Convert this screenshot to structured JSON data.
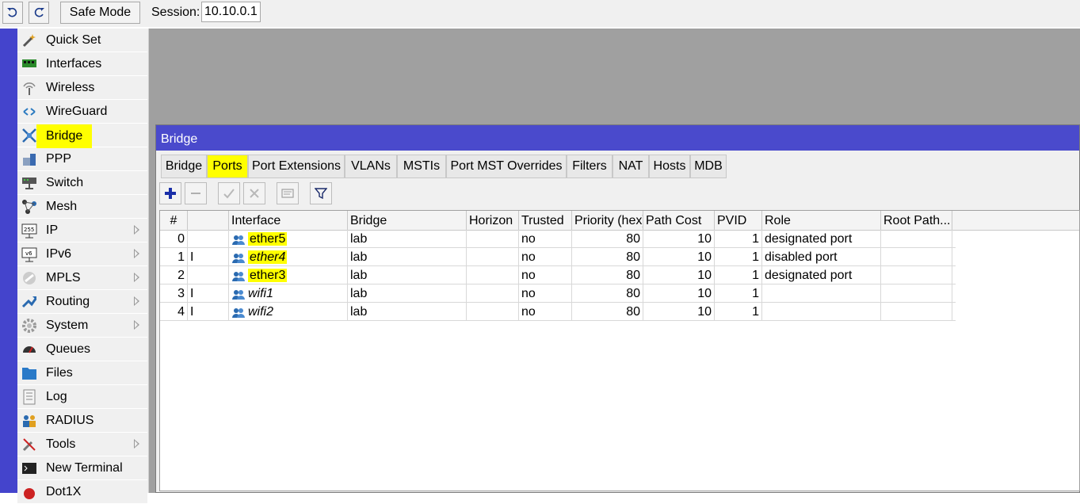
{
  "toolbar": {
    "undo_icon": "undo-icon",
    "redo_icon": "redo-icon",
    "safe_mode_label": "Safe Mode",
    "session_label": "Session:",
    "session_value": "10.10.0.1"
  },
  "menu": {
    "items": [
      {
        "label": "Quick Set",
        "icon": "wand-icon",
        "submenu": false
      },
      {
        "label": "Interfaces",
        "icon": "interfaces-icon",
        "submenu": false
      },
      {
        "label": "Wireless",
        "icon": "wireless-icon",
        "submenu": false
      },
      {
        "label": "WireGuard",
        "icon": "wireguard-icon",
        "submenu": false
      },
      {
        "label": "Bridge",
        "icon": "bridge-icon",
        "submenu": false,
        "highlighted": true
      },
      {
        "label": "PPP",
        "icon": "ppp-icon",
        "submenu": false
      },
      {
        "label": "Switch",
        "icon": "switch-icon",
        "submenu": false
      },
      {
        "label": "Mesh",
        "icon": "mesh-icon",
        "submenu": false
      },
      {
        "label": "IP",
        "icon": "ip-icon",
        "submenu": true
      },
      {
        "label": "IPv6",
        "icon": "ipv6-icon",
        "submenu": true
      },
      {
        "label": "MPLS",
        "icon": "mpls-icon",
        "submenu": true
      },
      {
        "label": "Routing",
        "icon": "routing-icon",
        "submenu": true
      },
      {
        "label": "System",
        "icon": "gear-icon",
        "submenu": true
      },
      {
        "label": "Queues",
        "icon": "queues-icon",
        "submenu": false
      },
      {
        "label": "Files",
        "icon": "folder-icon",
        "submenu": false
      },
      {
        "label": "Log",
        "icon": "log-icon",
        "submenu": false
      },
      {
        "label": "RADIUS",
        "icon": "radius-icon",
        "submenu": false
      },
      {
        "label": "Tools",
        "icon": "tools-icon",
        "submenu": true
      },
      {
        "label": "New Terminal",
        "icon": "terminal-icon",
        "submenu": false
      },
      {
        "label": "Dot1X",
        "icon": "dot1x-icon",
        "submenu": false
      }
    ]
  },
  "window": {
    "title": "Bridge",
    "tabs": [
      "Bridge",
      "Ports",
      "Port Extensions",
      "VLANs",
      "MSTIs",
      "Port MST Overrides",
      "Filters",
      "NAT",
      "Hosts",
      "MDB"
    ],
    "active_tab": "Ports",
    "tools": [
      "add-icon",
      "remove-icon",
      "enable-icon",
      "disable-icon",
      "comment-icon",
      "filter-icon"
    ]
  },
  "table": {
    "columns": [
      "#",
      "",
      "Interface",
      "Bridge",
      "Horizon",
      "Trusted",
      "Priority (hex)",
      "Path Cost",
      "PVID",
      "Role",
      "Root Path..."
    ],
    "rows": [
      {
        "num": "0",
        "flag": "",
        "interface": "ether5",
        "bridge": "lab",
        "horizon": "",
        "trusted": "no",
        "priority": "80",
        "path_cost": "10",
        "pvid": "1",
        "role": "designated port",
        "root_path": "",
        "italic": false,
        "highlight": true
      },
      {
        "num": "1",
        "flag": "I",
        "interface": "ether4",
        "bridge": "lab",
        "horizon": "",
        "trusted": "no",
        "priority": "80",
        "path_cost": "10",
        "pvid": "1",
        "role": "disabled port",
        "root_path": "",
        "italic": true,
        "highlight": true
      },
      {
        "num": "2",
        "flag": "",
        "interface": "ether3",
        "bridge": "lab",
        "horizon": "",
        "trusted": "no",
        "priority": "80",
        "path_cost": "10",
        "pvid": "1",
        "role": "designated port",
        "root_path": "",
        "italic": false,
        "highlight": true
      },
      {
        "num": "3",
        "flag": "I",
        "interface": "wifi1",
        "bridge": "lab",
        "horizon": "",
        "trusted": "no",
        "priority": "80",
        "path_cost": "10",
        "pvid": "1",
        "role": "",
        "root_path": "",
        "italic": true,
        "highlight": false
      },
      {
        "num": "4",
        "flag": "I",
        "interface": "wifi2",
        "bridge": "lab",
        "horizon": "",
        "trusted": "no",
        "priority": "80",
        "path_cost": "10",
        "pvid": "1",
        "role": "",
        "root_path": "",
        "italic": true,
        "highlight": false
      }
    ]
  },
  "colors": {
    "title_bar": "#4a4acc",
    "highlight": "#ffff00",
    "workspace": "#a0a0a0",
    "left_strip": "#4444cc"
  }
}
